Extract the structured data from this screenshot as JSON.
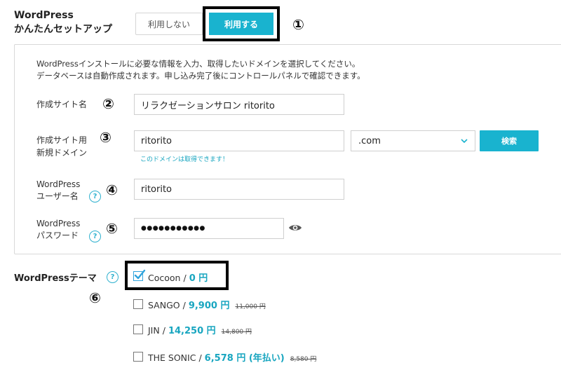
{
  "header": {
    "title_line1": "WordPress",
    "title_line2": "かんたんセットアップ",
    "toggle_off_label": "利用しない",
    "toggle_on_label": "利用する"
  },
  "markers": [
    "①",
    "②",
    "③",
    "④",
    "⑤",
    "⑥"
  ],
  "intro": {
    "line1": "WordPressインストールに必要な情報を入力、取得したいドメインを選択してください。",
    "line2": "データベースは自動作成されます。申し込み完了後にコントロールパネルで確認できます。"
  },
  "form": {
    "site_name": {
      "label": "作成サイト名",
      "value": "リラクゼーションサロン ritorito"
    },
    "domain": {
      "label_line1": "作成サイト用",
      "label_line2": "新規ドメイン",
      "value": "ritorito",
      "tld_selected": ".com",
      "search_label": "検索",
      "availability": "このドメインは取得できます！"
    },
    "username": {
      "label_line1": "WordPress",
      "label_line2": "ユーザー名",
      "value": "ritorito"
    },
    "password": {
      "label_line1": "WordPress",
      "label_line2": "パスワード",
      "masked_value": "●●●●●●●●●●●"
    },
    "help_glyph": "?"
  },
  "theme": {
    "label": "WordPressテーマ",
    "items": [
      {
        "name": "Cocoon",
        "sep": "/",
        "price": "0 円",
        "old_price": "",
        "checked": true
      },
      {
        "name": "SANGO",
        "sep": "/",
        "price": "9,900 円",
        "old_price": "11,000 円",
        "checked": false
      },
      {
        "name": "JIN",
        "sep": "/",
        "price": "14,250 円",
        "old_price": "14,800 円",
        "checked": false
      },
      {
        "name": "THE SONIC",
        "sep": "/",
        "price": "6,578 円 (年払い)",
        "old_price": "8,580 円",
        "checked": false
      }
    ]
  },
  "colors": {
    "accent": "#19b3cf",
    "highlight_border": "#000000"
  },
  "icons": [
    "help-icon",
    "eye-icon",
    "chevron-down-icon",
    "checkmark-icon"
  ]
}
